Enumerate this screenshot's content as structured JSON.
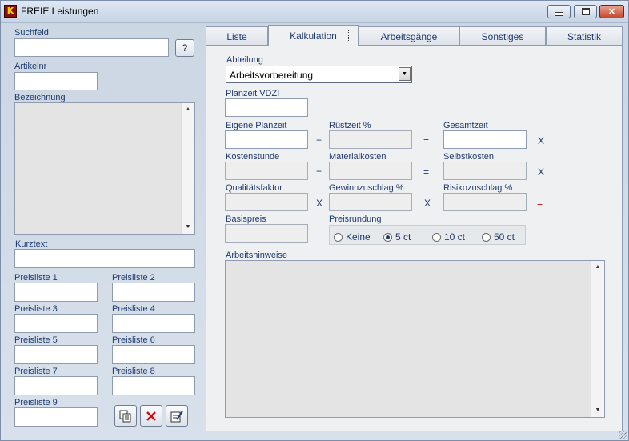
{
  "window": {
    "title": "FREIE Leistungen",
    "app_icon": "app-logo-icon",
    "buttons": {
      "minimize": "minimize-icon",
      "maximize": "maximize-icon",
      "close": "close-icon"
    }
  },
  "left": {
    "suchfeld_label": "Suchfeld",
    "suchfeld_value": "",
    "help_button": "?",
    "artikelnr_label": "Artikelnr",
    "artikelnr_value": "",
    "bezeichnung_label": "Bezeichnung",
    "bezeichnung_value": "",
    "kurztext_label": "Kurztext",
    "kurztext_value": "",
    "preislisten": [
      {
        "label": "Preisliste 1",
        "value": ""
      },
      {
        "label": "Preisliste 2",
        "value": ""
      },
      {
        "label": "Preisliste 3",
        "value": ""
      },
      {
        "label": "Preisliste 4",
        "value": ""
      },
      {
        "label": "Preisliste 5",
        "value": ""
      },
      {
        "label": "Preisliste 6",
        "value": ""
      },
      {
        "label": "Preisliste 7",
        "value": ""
      },
      {
        "label": "Preisliste 8",
        "value": ""
      },
      {
        "label": "Preisliste 9",
        "value": ""
      }
    ],
    "action_icons": [
      "copy-icon",
      "delete-icon",
      "edit-icon"
    ]
  },
  "tabs": [
    {
      "label": "Liste",
      "active": false
    },
    {
      "label": "Kalkulation",
      "active": true
    },
    {
      "label": "Arbeitsgänge",
      "active": false
    },
    {
      "label": "Sonstiges",
      "active": false
    },
    {
      "label": "Statistik",
      "active": false
    }
  ],
  "kalkulation": {
    "abteilung_label": "Abteilung",
    "abteilung_value": "Arbeitsvorbereitung",
    "planzeit_vdzi_label": "Planzeit VDZI",
    "eigene_planzeit_label": "Eigene Planzeit",
    "ruestzeit_label": "Rüstzeit %",
    "gesamtzeit_label": "Gesamtzeit",
    "kostenstunde_label": "Kostenstunde",
    "materialkosten_label": "Materialkosten",
    "selbstkosten_label": "Selbstkosten",
    "qualitaetsfaktor_label": "Qualitätsfaktor",
    "gewinnzuschlag_label": "Gewinnzuschlag %",
    "risikozuschlag_label": "Risikozuschlag %",
    "basispreis_label": "Basispreis",
    "preisrundung_label": "Preisrundung",
    "preisrundung_options": [
      "Keine",
      "5 ct",
      "10 ct",
      "50 ct"
    ],
    "preisrundung_selected": "5 ct",
    "arbeitshinweise_label": "Arbeitshinweise",
    "ops": {
      "plus": "+",
      "equals": "=",
      "times": "X"
    },
    "colors": {
      "red_equals": "#d00000",
      "text": "#1f3a6e"
    }
  }
}
